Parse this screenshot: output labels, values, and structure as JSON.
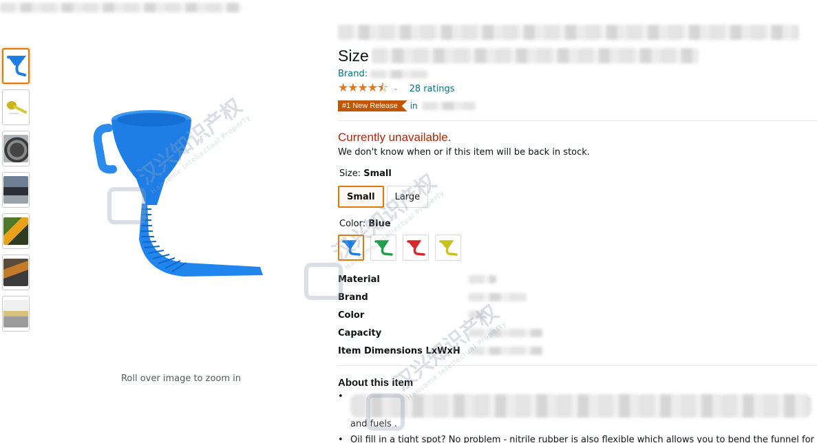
{
  "product": {
    "title_visible_word": "Size",
    "brand_label": "Brand:",
    "stars": "★★★★⯪",
    "ratings": "28 ratings",
    "badge": "#1 New Release",
    "badge_in": "in"
  },
  "availability": {
    "status": "Currently unavailable.",
    "message": "We don't know when or if this item will be back in stock.",
    "status_color": "#b12704"
  },
  "size": {
    "label": "Size:",
    "selected": "Small",
    "options": [
      "Small",
      "Large"
    ]
  },
  "color": {
    "label": "Color:",
    "selected": "Blue",
    "options": [
      {
        "name": "Blue",
        "hex": "#1e7ee6"
      },
      {
        "name": "Green",
        "hex": "#1f9e4a"
      },
      {
        "name": "Red",
        "hex": "#d9262b"
      },
      {
        "name": "Yellow",
        "hex": "#c9c21a"
      }
    ]
  },
  "specs": [
    "Material",
    "Brand",
    "Color",
    "Capacity",
    "Item Dimensions LxWxH"
  ],
  "gallery": {
    "zoom_hint": "Roll over image to zoom in",
    "thumbnail_count": 7
  },
  "about": {
    "heading": "About this item",
    "bullet_tail": "and fuels .",
    "bullet2": "Oil fill in a tight spot? No problem - nitrile rubber is also flexible which allows you to bend the funnel for"
  },
  "watermark": {
    "text": "汉兴知识产权",
    "sub": "Hansome Intellectual Property"
  },
  "accent_color": "#e77600",
  "link_color": "#007185"
}
